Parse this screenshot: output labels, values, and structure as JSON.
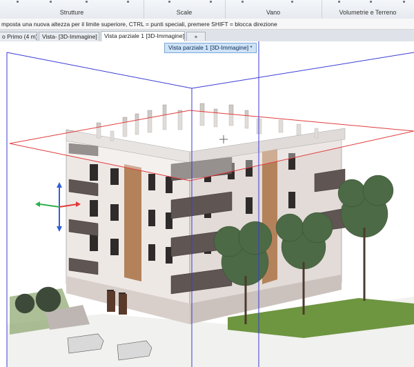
{
  "ribbon": {
    "groups": [
      {
        "name": "group-strutture",
        "label": "Strutture"
      },
      {
        "name": "group-scale",
        "label": "Scale"
      },
      {
        "name": "group-vano",
        "label": "Vano"
      },
      {
        "name": "group-volumetrie",
        "label": "Volumetrie e Terreno"
      }
    ]
  },
  "hint": {
    "text": "mposta una nuova altezza per il limite superiore, CTRL = punti speciali, premere SHIFT = blocca direzione"
  },
  "tabs": [
    {
      "label": "o Primo (4 m) *"
    },
    {
      "label": "Vista- [3D-Immagine] *"
    },
    {
      "label": "Vista parziale 1 [3D-Immagine] *"
    },
    {
      "label": "+"
    }
  ],
  "tooltip": {
    "text": "Vista parziale 1 [3D-Immagine] *"
  },
  "colors": {
    "clip_box": "#3a3ad6",
    "height_plane": "#e23a3a",
    "wall": "#efe9e6",
    "wall_shade": "#d9d1cd",
    "wood": "#b27c55",
    "balcony": "#5f5553",
    "tree": "#4f6e48",
    "grass": "#5f8a3a",
    "axis_z": "#2f5fd8",
    "axis_x": "#e03a3a",
    "axis_y": "#2fae4e"
  }
}
